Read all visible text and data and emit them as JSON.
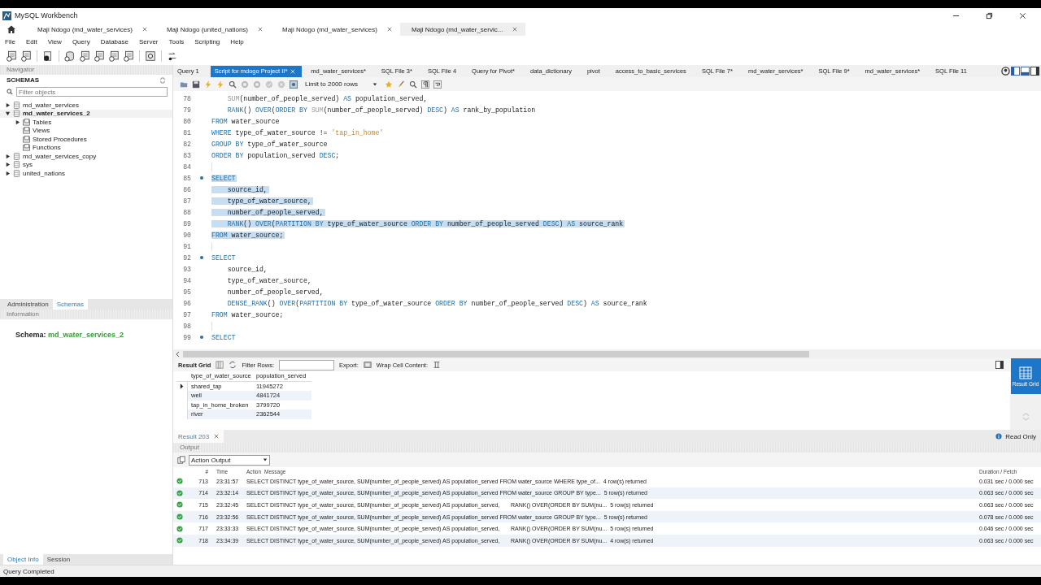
{
  "window": {
    "title": "MySQL Workbench"
  },
  "connection_tabs": [
    {
      "label": "Maji Ndogo (md_water_services)",
      "selected": false
    },
    {
      "label": "Maji Ndogo (united_nations)",
      "selected": false
    },
    {
      "label": "Maji Ndogo (md_water_services)",
      "selected": false
    },
    {
      "label": "Maji Ndogo (md_water_servic...",
      "selected": true
    }
  ],
  "menu": [
    "File",
    "Edit",
    "View",
    "Query",
    "Database",
    "Server",
    "Tools",
    "Scripting",
    "Help"
  ],
  "navigator": {
    "title": "Navigator",
    "schemas_heading": "SCHEMAS",
    "filter_placeholder": "Filter objects",
    "tree": [
      {
        "label": "md_water_services",
        "kind": "schema",
        "expandable": true,
        "expanded": false,
        "selected": false
      },
      {
        "label": "md_water_services_2",
        "kind": "schema",
        "expandable": true,
        "expanded": true,
        "selected": true,
        "children": [
          {
            "label": "Tables",
            "kind": "folder",
            "expandable": true,
            "expanded": false,
            "selected": false
          },
          {
            "label": "Views",
            "kind": "folder",
            "expandable": false,
            "selected": false
          },
          {
            "label": "Stored Procedures",
            "kind": "folder",
            "expandable": false,
            "selected": false
          },
          {
            "label": "Functions",
            "kind": "folder",
            "expandable": false,
            "selected": false
          }
        ]
      },
      {
        "label": "md_water_services_copy",
        "kind": "schema",
        "expandable": true,
        "expanded": false,
        "selected": false
      },
      {
        "label": "sys",
        "kind": "schema",
        "expandable": true,
        "expanded": false,
        "selected": false
      },
      {
        "label": "united_nations",
        "kind": "schema",
        "expandable": true,
        "expanded": false,
        "selected": false
      }
    ],
    "tabs": [
      {
        "label": "Administration",
        "selected": false
      },
      {
        "label": "Schemas",
        "selected": true
      }
    ],
    "information_title": "Information",
    "schema_label": "Schema:",
    "schema_value": "md_water_services_2",
    "bottom_tabs": [
      {
        "label": "Object Info",
        "selected": true
      },
      {
        "label": "Session",
        "selected": false
      }
    ]
  },
  "editor_tabs": [
    {
      "label": "Query 1",
      "selected": false
    },
    {
      "label": "Script for mdogo Project II*",
      "selected": true
    },
    {
      "label": "md_water_services*",
      "selected": false
    },
    {
      "label": "SQL File 3*",
      "selected": false
    },
    {
      "label": "SQL File 4",
      "selected": false
    },
    {
      "label": "Query for Pivot*",
      "selected": false
    },
    {
      "label": "data_dictionary",
      "selected": false
    },
    {
      "label": "pivot",
      "selected": false
    },
    {
      "label": "access_to_basic_services",
      "selected": false
    },
    {
      "label": "SQL File 7*",
      "selected": false
    },
    {
      "label": "md_water_services*",
      "selected": false
    },
    {
      "label": "SQL File 9*",
      "selected": false
    },
    {
      "label": "md_water_services*",
      "selected": false
    },
    {
      "label": "SQL File 11",
      "selected": false
    }
  ],
  "limit_dropdown": "Limit to 2000 rows",
  "code_lines": [
    {
      "number": "78",
      "marker": false,
      "selected": false,
      "tokens": [
        {
          "kind": "fn",
          "text": "    SUM"
        },
        {
          "kind": "plain",
          "text": "(number_of_people_served) "
        },
        {
          "kind": "kw",
          "text": "AS"
        },
        {
          "kind": "plain",
          "text": " population_served,"
        }
      ]
    },
    {
      "number": "79",
      "marker": false,
      "selected": false,
      "tokens": [
        {
          "kind": "kw",
          "text": "    RANK"
        },
        {
          "kind": "plain",
          "text": "() "
        },
        {
          "kind": "kw",
          "text": "OVER"
        },
        {
          "kind": "plain",
          "text": "("
        },
        {
          "kind": "kw",
          "text": "ORDER BY "
        },
        {
          "kind": "fn",
          "text": "SUM"
        },
        {
          "kind": "plain",
          "text": "(number_of_people_served) "
        },
        {
          "kind": "kw",
          "text": "DESC"
        },
        {
          "kind": "plain",
          "text": ") "
        },
        {
          "kind": "kw",
          "text": "AS"
        },
        {
          "kind": "plain",
          "text": " rank_by_population"
        }
      ]
    },
    {
      "number": "80",
      "marker": false,
      "selected": false,
      "tokens": [
        {
          "kind": "kw",
          "text": "FROM"
        },
        {
          "kind": "plain",
          "text": " water_source"
        }
      ]
    },
    {
      "number": "81",
      "marker": false,
      "selected": false,
      "tokens": [
        {
          "kind": "kw",
          "text": "WHERE"
        },
        {
          "kind": "plain",
          "text": " type_of_water_source != "
        },
        {
          "kind": "str",
          "text": "'tap_in_home'"
        }
      ]
    },
    {
      "number": "82",
      "marker": false,
      "selected": false,
      "tokens": [
        {
          "kind": "kw",
          "text": "GROUP BY"
        },
        {
          "kind": "plain",
          "text": " type_of_water_source"
        }
      ]
    },
    {
      "number": "83",
      "marker": false,
      "selected": false,
      "tokens": [
        {
          "kind": "kw",
          "text": "ORDER BY"
        },
        {
          "kind": "plain",
          "text": " population_served "
        },
        {
          "kind": "kw",
          "text": "DESC"
        },
        {
          "kind": "plain",
          "text": ";"
        }
      ]
    },
    {
      "number": "84",
      "marker": false,
      "selected": false
    },
    {
      "number": "85",
      "marker": true,
      "selected": true,
      "tokens": [
        {
          "kind": "kw",
          "text": "SELECT"
        }
      ]
    },
    {
      "number": "86",
      "marker": false,
      "selected": true,
      "tokens": [
        {
          "kind": "plain",
          "text": "    source_id,"
        }
      ]
    },
    {
      "number": "87",
      "marker": false,
      "selected": true,
      "tokens": [
        {
          "kind": "plain",
          "text": "    type_of_water_source,"
        }
      ]
    },
    {
      "number": "88",
      "marker": false,
      "selected": true,
      "tokens": [
        {
          "kind": "plain",
          "text": "    number_of_people_served,"
        }
      ]
    },
    {
      "number": "89",
      "marker": false,
      "selected": true,
      "tokens": [
        {
          "kind": "kw",
          "text": "    RANK"
        },
        {
          "kind": "plain",
          "text": "() "
        },
        {
          "kind": "kw",
          "text": "OVER"
        },
        {
          "kind": "plain",
          "text": "("
        },
        {
          "kind": "kw",
          "text": "PARTITION BY"
        },
        {
          "kind": "plain",
          "text": " type_of_water_source "
        },
        {
          "kind": "kw",
          "text": "ORDER BY"
        },
        {
          "kind": "plain",
          "text": " number_of_people_served "
        },
        {
          "kind": "kw",
          "text": "DESC"
        },
        {
          "kind": "plain",
          "text": ") "
        },
        {
          "kind": "kw",
          "text": "AS"
        },
        {
          "kind": "plain",
          "text": " source_rank"
        }
      ]
    },
    {
      "number": "90",
      "marker": false,
      "selected": true,
      "tokens": [
        {
          "kind": "kw",
          "text": "FROM"
        },
        {
          "kind": "plain",
          "text": " water_source;"
        }
      ]
    },
    {
      "number": "91",
      "marker": false,
      "selected": false
    },
    {
      "number": "92",
      "marker": true,
      "selected": false,
      "tokens": [
        {
          "kind": "kw",
          "text": "SELECT"
        }
      ]
    },
    {
      "number": "93",
      "marker": false,
      "selected": false,
      "tokens": [
        {
          "kind": "plain",
          "text": "    source_id,"
        }
      ]
    },
    {
      "number": "94",
      "marker": false,
      "selected": false,
      "tokens": [
        {
          "kind": "plain",
          "text": "    type_of_water_source,"
        }
      ]
    },
    {
      "number": "95",
      "marker": false,
      "selected": false,
      "tokens": [
        {
          "kind": "plain",
          "text": "    number_of_people_served,"
        }
      ]
    },
    {
      "number": "96",
      "marker": false,
      "selected": false,
      "tokens": [
        {
          "kind": "kw",
          "text": "    DENSE_RANK"
        },
        {
          "kind": "plain",
          "text": "() "
        },
        {
          "kind": "kw",
          "text": "OVER"
        },
        {
          "kind": "plain",
          "text": "("
        },
        {
          "kind": "kw",
          "text": "PARTITION BY"
        },
        {
          "kind": "plain",
          "text": " type_of_water_source "
        },
        {
          "kind": "kw",
          "text": "ORDER BY"
        },
        {
          "kind": "plain",
          "text": " number_of_people_served "
        },
        {
          "kind": "kw",
          "text": "DESC"
        },
        {
          "kind": "plain",
          "text": ") "
        },
        {
          "kind": "kw",
          "text": "AS"
        },
        {
          "kind": "plain",
          "text": " source_rank"
        }
      ]
    },
    {
      "number": "97",
      "marker": false,
      "selected": false,
      "tokens": [
        {
          "kind": "kw",
          "text": "FROM"
        },
        {
          "kind": "plain",
          "text": " water_source;"
        }
      ]
    },
    {
      "number": "98",
      "marker": false,
      "selected": false
    },
    {
      "number": "99",
      "marker": true,
      "selected": false,
      "tokens": [
        {
          "kind": "kw",
          "text": "SELECT"
        }
      ]
    }
  ],
  "result_toolbar": {
    "result_grid": "Result Grid",
    "filter_label": "Filter Rows:",
    "export_label": "Export:",
    "wrap_label": "Wrap Cell Content:"
  },
  "result_grid": {
    "columns": [
      "type_of_water_source",
      "population_served"
    ],
    "rows": [
      {
        "selected": true,
        "cells": [
          "shared_tap",
          "11945272"
        ]
      },
      {
        "selected": false,
        "cells": [
          "well",
          "4841724"
        ]
      },
      {
        "selected": false,
        "cells": [
          "tap_in_home_broken",
          "3799720"
        ]
      },
      {
        "selected": false,
        "cells": [
          "river",
          "2362544"
        ]
      }
    ]
  },
  "side_panel": {
    "result_grid_button": "Result Grid",
    "selected": true
  },
  "result_tabs": [
    {
      "label": "Result 203",
      "selected": true
    }
  ],
  "read_only": "Read Only",
  "output": {
    "title": "Output",
    "selector": "Action Output",
    "columns": [
      "#",
      "Time",
      "Action",
      "Message",
      "Duration / Fetch"
    ],
    "rows": [
      {
        "succeeded": true,
        "number": "713",
        "time": "23:31:57",
        "action": "SELECT DISTINCT type_of_water_source, SUM(number_of_people_served) AS population_served FROM water_source WHERE type_of...",
        "message": "4 row(s) returned",
        "duration": "0.031 sec / 0.000 sec"
      },
      {
        "succeeded": true,
        "number": "714",
        "time": "23:32:14",
        "action": "SELECT DISTINCT type_of_water_source, SUM(number_of_people_served) AS population_served FROM water_source GROUP BY type...",
        "message": "5 row(s) returned",
        "duration": "0.063 sec / 0.000 sec"
      },
      {
        "succeeded": true,
        "number": "715",
        "time": "23:32:45",
        "action": "SELECT DISTINCT type_of_water_source, SUM(number_of_people_served) AS population_served,       RANK() OVER(ORDER BY SUM(nu...",
        "message": "5 row(s) returned",
        "duration": "0.063 sec / 0.000 sec"
      },
      {
        "succeeded": true,
        "number": "716",
        "time": "23:32:56",
        "action": "SELECT DISTINCT type_of_water_source, SUM(number_of_people_served) AS population_served FROM water_source GROUP BY type...",
        "message": "5 row(s) returned",
        "duration": "0.078 sec / 0.000 sec"
      },
      {
        "succeeded": true,
        "number": "717",
        "time": "23:33:33",
        "action": "SELECT DISTINCT type_of_water_source, SUM(number_of_people_served) AS population_served,       RANK() OVER(ORDER BY SUM(nu...",
        "message": "5 row(s) returned",
        "duration": "0.046 sec / 0.000 sec"
      },
      {
        "succeeded": true,
        "number": "718",
        "time": "23:34:39",
        "action": "SELECT DISTINCT type_of_water_source, SUM(number_of_people_served) AS population_served,       RANK() OVER(ORDER BY SUM(nu...",
        "message": "4 row(s) returned",
        "duration": "0.063 sec / 0.000 sec"
      }
    ]
  },
  "status_bar": "Query Completed"
}
